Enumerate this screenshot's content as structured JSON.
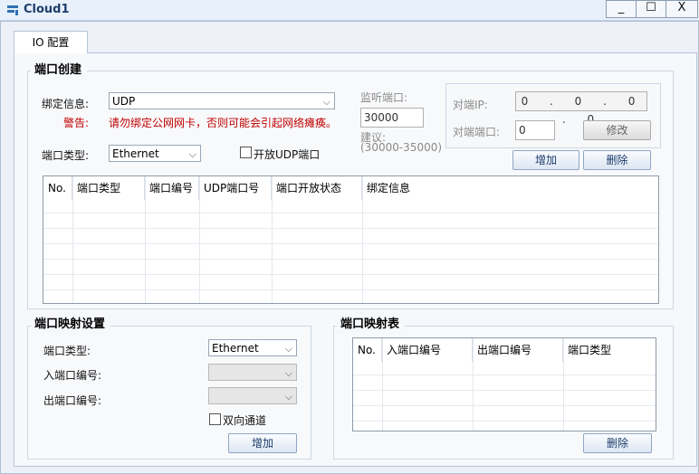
{
  "window": {
    "title": "Cloud1",
    "minimize": "_",
    "maximize": "☐",
    "close": "X"
  },
  "tabs": [
    {
      "label": "IO 配置"
    }
  ],
  "port_create": {
    "title": "端口创建",
    "bind_label": "绑定信息:",
    "bind_value": "UDP",
    "warning_label": "警告:",
    "warning_text": "请勿绑定公网网卡，否则可能会引起网络瘫痪。",
    "port_type_label": "端口类型:",
    "port_type_value": "Ethernet",
    "open_udp_label": "开放UDP端口",
    "listen_port_label": "监听端口:",
    "listen_port_value": "30000",
    "suggest_label": "建议:",
    "suggest_range": "(30000-35000)",
    "peer_ip_label": "对端IP:",
    "peer_ip_value": "0 . 0 . 0 . 0",
    "peer_port_label": "对端端口:",
    "peer_port_value": "0",
    "modify_button": "修改",
    "add_button": "增加",
    "delete_button": "删除",
    "table_headers": [
      "No.",
      "端口类型",
      "端口编号",
      "UDP端口号",
      "端口开放状态",
      "绑定信息"
    ]
  },
  "port_mapping_settings": {
    "title": "端口映射设置",
    "port_type_label": "端口类型:",
    "port_type_value": "Ethernet",
    "in_port_label": "入端口编号:",
    "out_port_label": "出端口编号:",
    "bidirectional_label": "双向通道",
    "add_button": "增加"
  },
  "port_mapping_table": {
    "title": "端口映射表",
    "table_headers": [
      "No.",
      "入端口编号",
      "出端口编号",
      "端口类型"
    ],
    "delete_button": "删除"
  }
}
